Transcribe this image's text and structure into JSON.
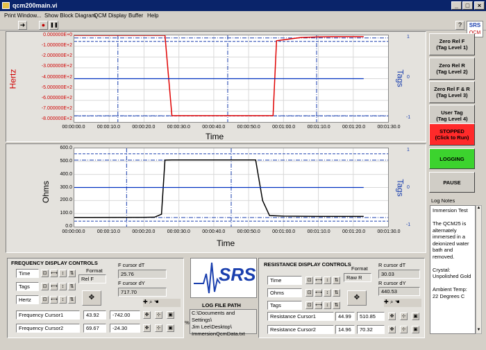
{
  "window": {
    "title": "qcm200main.vi",
    "min": "_",
    "max": "□",
    "close": "×"
  },
  "menu": [
    "Print Window...",
    "Show Block Diagram",
    "QCM",
    "Display",
    "Buffer",
    "Help"
  ],
  "toolbar": {
    "run_arrow": "➜",
    "stop": "●",
    "pause": "❚❚",
    "help": "?"
  },
  "logo_small": {
    "text": "SRS",
    "sub": "QCM"
  },
  "freq_chart": {
    "ylabel": "Hertz",
    "y2label": "Tags",
    "xlabel": "Time",
    "yticks": [
      "0.000000E+0",
      "-1.000000E+2",
      "-2.000000E+2",
      "-3.000000E+2",
      "-4.000000E+2",
      "-5.000000E+2",
      "-6.000000E+2",
      "-7.000000E+2",
      "-8.000000E+2"
    ],
    "y2ticks": [
      "1",
      "0",
      "-1"
    ],
    "xticks": [
      "00:00:00.0",
      "00:00:10.0",
      "00:00:20.0",
      "00:00:30.0",
      "00:00:40.0",
      "00:00:50.0",
      "00:01:00.0",
      "00:01:10.0",
      "00:01:20.0",
      "00:01:30.0"
    ]
  },
  "res_chart": {
    "ylabel": "Ohms",
    "y2label": "Tags",
    "xlabel": "Time",
    "yticks": [
      "600.0",
      "500.0",
      "400.0",
      "300.0",
      "200.0",
      "100.0",
      "0.0"
    ],
    "y2ticks": [
      "1",
      "0",
      "-1"
    ],
    "xticks": [
      "00:00:00.0",
      "00:00:10.0",
      "00:00:20.0",
      "00:00:30.0",
      "00:00:40.0",
      "00:00:50.0",
      "00:01:00.0",
      "00:01:10.0",
      "00:01:20.0",
      "00:01:30.0"
    ]
  },
  "chart_data": [
    {
      "type": "line",
      "title": "",
      "xlabel": "Time",
      "ylabel": "Hertz",
      "y2label": "Tags",
      "xlim": [
        0,
        90
      ],
      "ylim": [
        -800,
        0
      ],
      "y2lim": [
        -1,
        1
      ],
      "series": [
        {
          "color": "#e00000",
          "x": [
            0,
            26,
            28,
            55,
            57,
            58,
            65,
            70,
            74,
            83
          ],
          "y": [
            0,
            0,
            -742,
            -742,
            -742,
            -50,
            -20,
            -15,
            -12,
            -12
          ]
        },
        {
          "color": "#0030c0",
          "axis": "y2",
          "x": [
            0,
            83
          ],
          "y": [
            0,
            0
          ]
        }
      ],
      "cursors_x": [
        12.5,
        44,
        69.5
      ],
      "cursors_y": [
        -24,
        -742
      ]
    },
    {
      "type": "line",
      "title": "",
      "xlabel": "Time",
      "ylabel": "Ohms",
      "y2label": "Tags",
      "xlim": [
        0,
        90
      ],
      "ylim": [
        0,
        600
      ],
      "y2lim": [
        -1,
        1
      ],
      "series": [
        {
          "color": "#000000",
          "x": [
            0,
            20,
            23,
            25,
            26,
            28,
            50,
            52,
            54,
            56,
            60,
            70,
            83
          ],
          "y": [
            70,
            71,
            72,
            95,
            510,
            511,
            511,
            511,
            200,
            85,
            80,
            78,
            78
          ]
        },
        {
          "color": "#0030c0",
          "axis": "y2",
          "x": [
            0,
            83
          ],
          "y": [
            0,
            0
          ]
        }
      ],
      "cursors_x": [
        15,
        45
      ],
      "cursors_y": [
        510,
        70
      ]
    }
  ],
  "side_buttons": [
    {
      "line1": "Zero Rel F",
      "line2": "(Tag Level 1)"
    },
    {
      "line1": "Zero Rel R",
      "line2": "(Tag Level 2)"
    },
    {
      "line1": "Zero Rel F & R",
      "line2": "(Tag Level 3)"
    },
    {
      "line1": "User Tag",
      "line2": "(Tag Level 4)"
    }
  ],
  "stopped": {
    "line1": "STOPPED",
    "line2": "(Click to Run)"
  },
  "logging": "LOGGING",
  "pause": "PAUSE",
  "log_notes": {
    "label": "Log Notes",
    "lines": [
      "Immersion Test",
      "",
      "The QCM25 is",
      "alternately",
      "immersed in a",
      "deionized water",
      "bath and",
      "removed.",
      "",
      "Crystal:",
      "Unpolished Gold",
      "",
      "Ambient Temp:",
      "22 Degrees C"
    ]
  },
  "freq_controls": {
    "title": "FREQUENCY DISPLAY CONTROLS",
    "rows": [
      "Time",
      "Tags",
      "Hertz"
    ],
    "format_label": "Format",
    "format_value": "Rel F",
    "cursor_dt_label": "F cursor dT",
    "cursor_dt_value": "25.76",
    "cursor_dy_label": "F cursor dY",
    "cursor_dy_value": "717.70",
    "cursor1": {
      "name": "Frequency Cursor1",
      "x": "43.92",
      "y": "-742.00"
    },
    "cursor2": {
      "name": "Frequency Cursor2",
      "x": "69.67",
      "y": "-24.30"
    }
  },
  "res_controls": {
    "title": "RESISTANCE DISPLAY CONTROLS",
    "rows": [
      "Time",
      "Ohms",
      "Tags"
    ],
    "format_label": "Format",
    "format_value": "Raw R",
    "cursor_dt_label": "R cursor dT",
    "cursor_dt_value": "30.03",
    "cursor_dy_label": "R cursor dY",
    "cursor_dy_value": "440.53",
    "cursor1": {
      "name": "Resistance Cursor1",
      "x": "44.99",
      "y": "510.85"
    },
    "cursor2": {
      "name": "Resistance Cursor2",
      "x": "14.96",
      "y": "70.32"
    }
  },
  "logo_big": {
    "text": "SRS"
  },
  "log_file": {
    "label": "LOG FILE PATH",
    "path_lines": [
      "C:\\Documents and Settings\\",
      "Jim Lee\\Desktop\\",
      "ImmersionQcmData.txt"
    ],
    "prefix": "%"
  }
}
